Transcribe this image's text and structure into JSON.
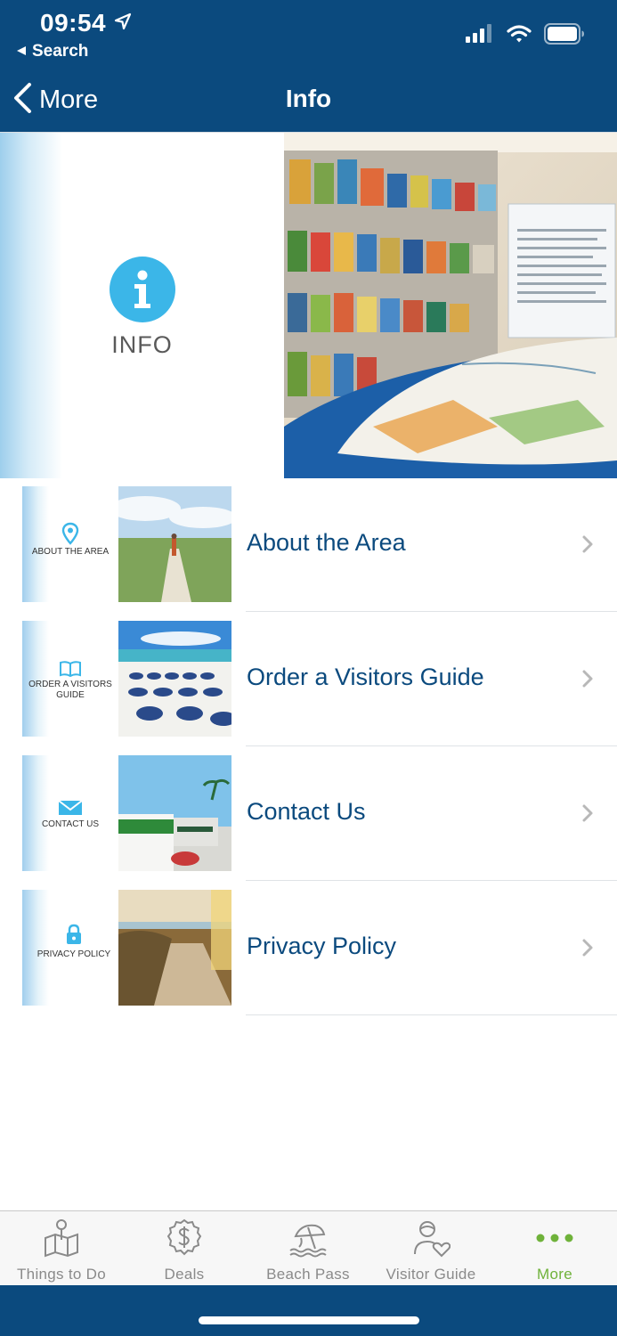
{
  "status_bar": {
    "time": "09:54",
    "back_app": "Search"
  },
  "nav": {
    "back_label": "More",
    "title": "Info"
  },
  "hero": {
    "badge_text": "INFO"
  },
  "items": [
    {
      "tile_label": "About the Area",
      "label": "About the Area"
    },
    {
      "tile_label": "Order a Visitors Guide",
      "label": "Order a Visitors Guide"
    },
    {
      "tile_label": "Contact Us",
      "label": "Contact Us"
    },
    {
      "tile_label": "Privacy Policy",
      "label": "Privacy Policy"
    }
  ],
  "tabs": [
    {
      "label": "Things to Do",
      "icon": "map-pin-icon"
    },
    {
      "label": "Deals",
      "icon": "dollar-badge-icon"
    },
    {
      "label": "Beach Pass",
      "icon": "beach-umbrella-icon"
    },
    {
      "label": "Visitor Guide",
      "icon": "person-heart-icon"
    },
    {
      "label": "More",
      "icon": "more-dots-icon",
      "active": true
    }
  ],
  "colors": {
    "brand": "#0b4a7e",
    "accent": "#3bb6e8",
    "active_tab": "#6fb23a"
  }
}
